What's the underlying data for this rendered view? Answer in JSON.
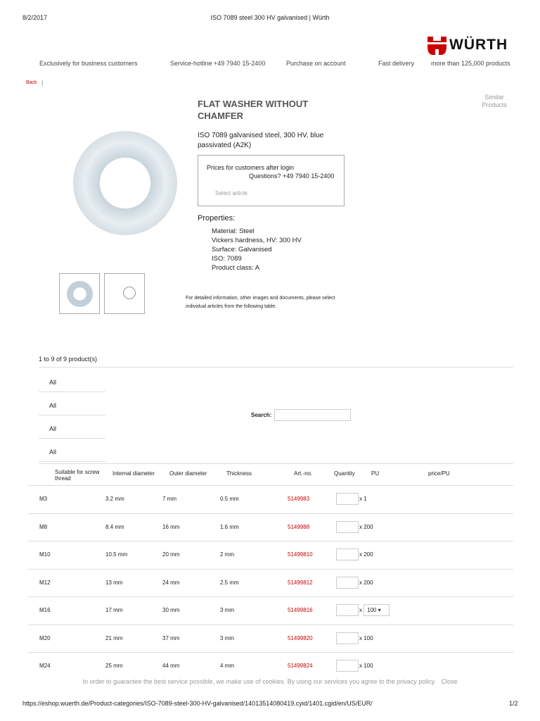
{
  "print_header": {
    "date": "8/2/2017",
    "title": "ISO 7089 steel 300 HV galvanised | Würth"
  },
  "logo": {
    "text": "WÜRTH",
    "color": "#cc0000"
  },
  "nav": [
    "Exclusively for business customers",
    "Service-hotline +49 7940 15-2400",
    "Purchase on account",
    "Fast delivery",
    "more than 125,000 products"
  ],
  "back": "Back",
  "similar": "Similar Products",
  "product": {
    "title": "FLAT WASHER WITHOUT CHAMFER",
    "description": "ISO 7089 galvanised steel, 300 HV, blue passivated (A2K)",
    "price_login": "Prices for customers after login",
    "questions": "Questions? +49 7940 15-2400",
    "select_article": "Select article",
    "properties_label": "Properties:",
    "properties": [
      "Material: Steel",
      "Vickers hardness, HV: 300 HV",
      "Surface: Galvanised",
      "ISO: 7089",
      "Product class: A"
    ],
    "info": "For detailed information, other images and documents, please select individual articles from the following table."
  },
  "count": "1 to 9 of 9 product(s)",
  "filters": [
    "All",
    "All",
    "All",
    "All"
  ],
  "search_label": "Search:",
  "table": {
    "headers": [
      "Suitable for screw thread",
      "Internal diameter",
      "Outer diameter",
      "Thickness",
      "Art.-no.",
      "Quantity",
      "PU",
      "price/PU"
    ],
    "rows": [
      [
        "M3",
        "3.2 mm",
        "7 mm",
        "0.5 mm",
        "5149983",
        "x 1"
      ],
      [
        "M8",
        "8.4 mm",
        "16 mm",
        "1.6 mm",
        "5149988",
        "x 200"
      ],
      [
        "M10",
        "10.5 mm",
        "20 mm",
        "2 mm",
        "51499810",
        "x 200"
      ],
      [
        "M12",
        "13 mm",
        "24 mm",
        "2.5 mm",
        "51499812",
        "x 200"
      ],
      [
        "M16",
        "17 mm",
        "30 mm",
        "3 mm",
        "51499816",
        "x",
        "100"
      ],
      [
        "M20",
        "21 mm",
        "37 mm",
        "3 mm",
        "51499820",
        "x 100"
      ],
      [
        "M24",
        "25 mm",
        "44 mm",
        "4 mm",
        "51499824",
        "x 100"
      ]
    ]
  },
  "cookie": {
    "text": "In order to guarantee the best service possible, we make use of cookies. By using our services you agree to the privacy policy.",
    "close": "Close"
  },
  "footer": {
    "url": "https://eshop.wuerth.de/Product-categories/ISO-7089-steel-300-HV-galvanised/14013514080419.cyid/1401.cgid/en/US/EUR/",
    "page": "1/2"
  }
}
